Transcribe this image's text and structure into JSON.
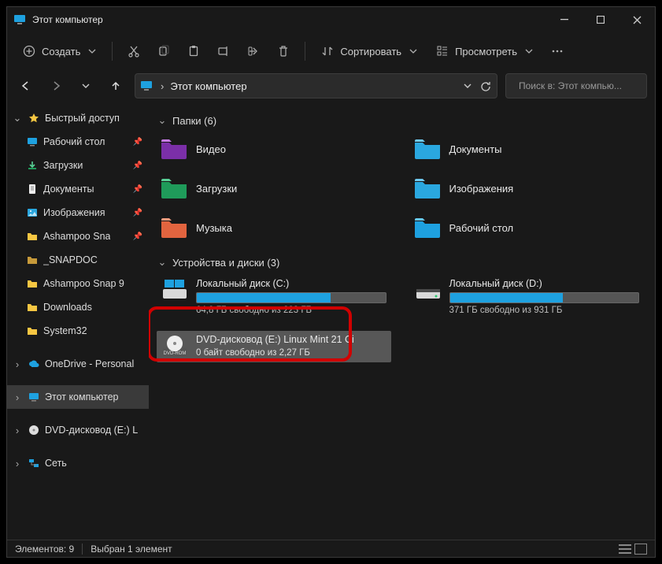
{
  "window": {
    "title": "Этот компьютер"
  },
  "toolbar": {
    "create": "Создать",
    "sort": "Сортировать",
    "view": "Просмотреть"
  },
  "breadcrumb": {
    "root": "Этот компьютер"
  },
  "search": {
    "placeholder": "Поиск в: Этот компью..."
  },
  "sidebar": {
    "quick": "Быстрый доступ",
    "items": [
      "Рабочий стол",
      "Загрузки",
      "Документы",
      "Изображения",
      "Ashampoo Sna",
      "_SNAPDOC",
      "Ashampoo Snap 9",
      "Downloads",
      "System32"
    ],
    "onedrive": "OneDrive - Personal",
    "thispc": "Этот компьютер",
    "dvd": "DVD-дисковод (E:) L",
    "network": "Сеть"
  },
  "groups": {
    "folders": {
      "title": "Папки (6)"
    },
    "drives": {
      "title": "Устройства и диски (3)"
    }
  },
  "folders": [
    {
      "label": "Видео",
      "color": "#7b2fa8",
      "accent": "#c77bea"
    },
    {
      "label": "Документы",
      "color": "#2aa7df",
      "accent": "#6fc9ef"
    },
    {
      "label": "Загрузки",
      "color": "#1f9b5a",
      "accent": "#59d197"
    },
    {
      "label": "Изображения",
      "color": "#2aa7df",
      "accent": "#6fc9ef"
    },
    {
      "label": "Музыка",
      "color": "#e2643f",
      "accent": "#f39a7d"
    },
    {
      "label": "Рабочий стол",
      "color": "#1ea1e0",
      "accent": "#66c6ef"
    }
  ],
  "drives": [
    {
      "name": "Локальный диск (C:)",
      "stat": "64,8 ГБ свободно из 223 ГБ",
      "fill": 71,
      "kind": "os"
    },
    {
      "name": "Локальный диск (D:)",
      "stat": "371 ГБ свободно из 931 ГБ",
      "fill": 60,
      "kind": "hdd"
    },
    {
      "name": "DVD-дисковод (E:) Linux Mint 21 Ci",
      "stat": "0 байт свободно из 2,27 ГБ",
      "fill": 0,
      "kind": "dvd",
      "selected": true
    }
  ],
  "status": {
    "count": "Элементов: 9",
    "selected": "Выбран 1 элемент"
  }
}
